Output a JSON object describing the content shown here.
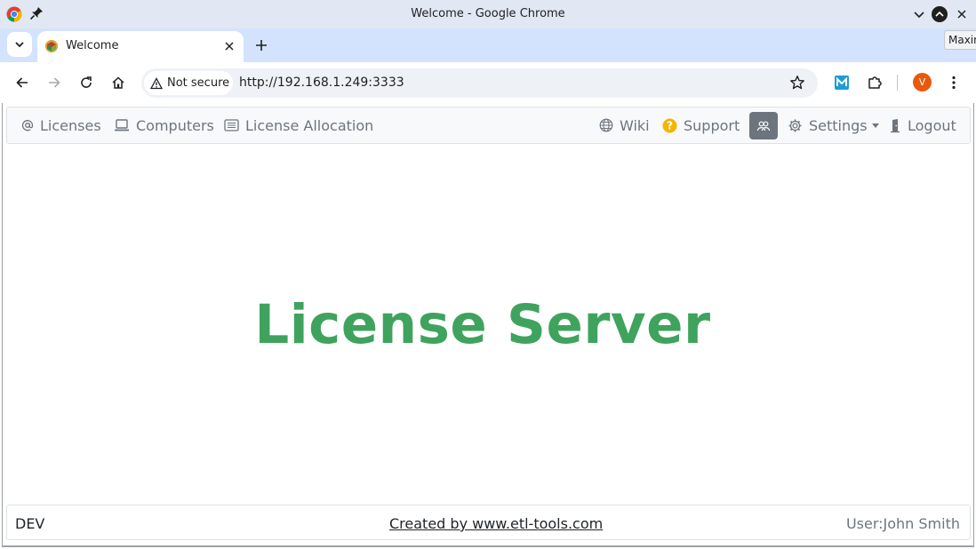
{
  "window": {
    "title": "Welcome - Google Chrome",
    "tooltip": "Maxim"
  },
  "tab": {
    "title": "Welcome"
  },
  "toolbar": {
    "security_chip": "Not secure",
    "url": "http://192.168.1.249:3333",
    "profile_initial": "V"
  },
  "nav": {
    "licenses": "Licenses",
    "computers": "Computers",
    "license_allocation": "License Allocation",
    "wiki": "Wiki",
    "support": "Support",
    "settings": "Settings",
    "logout": "Logout"
  },
  "hero": {
    "title": "License Server"
  },
  "footer": {
    "env": "DEV",
    "credit": "Created by www.etl-tools.com",
    "user": "User:John Smith"
  },
  "colors": {
    "brand_green": "#3fa35e",
    "nav_text": "#6c757d",
    "tab_strip": "#d3e3fd",
    "avatar": "#e8590c"
  }
}
